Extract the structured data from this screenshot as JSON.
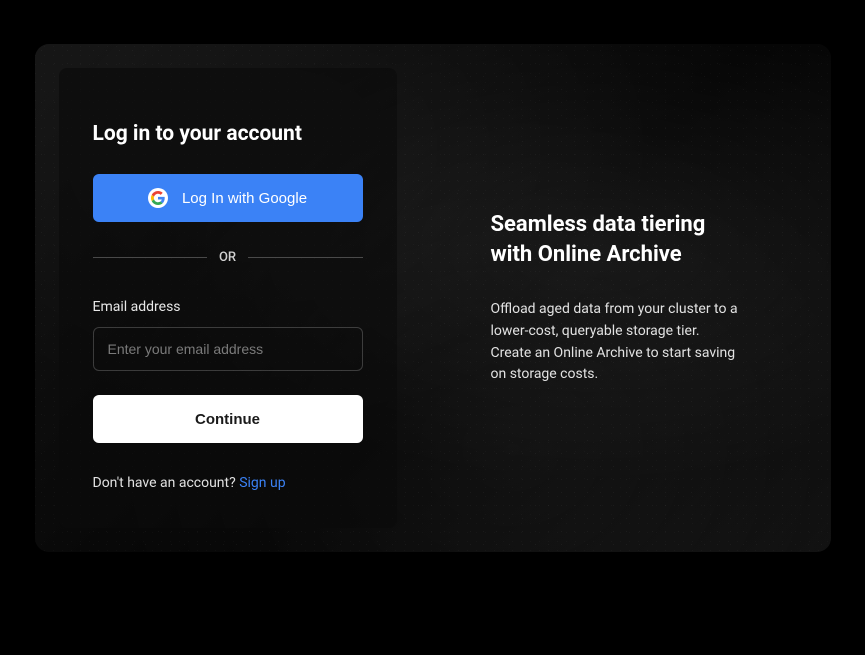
{
  "login": {
    "title": "Log in to your account",
    "google_button": "Log In with Google",
    "divider": "OR",
    "email_label": "Email address",
    "email_placeholder": "Enter your email address",
    "continue_button": "Continue",
    "signup_prompt": "Don't have an account? ",
    "signup_link": "Sign up"
  },
  "promo": {
    "title": "Seamless data tiering with Online Archive",
    "body": "Offload aged data from your cluster to a lower-cost, queryable storage tier. Create an Online Archive to start saving on storage costs."
  }
}
